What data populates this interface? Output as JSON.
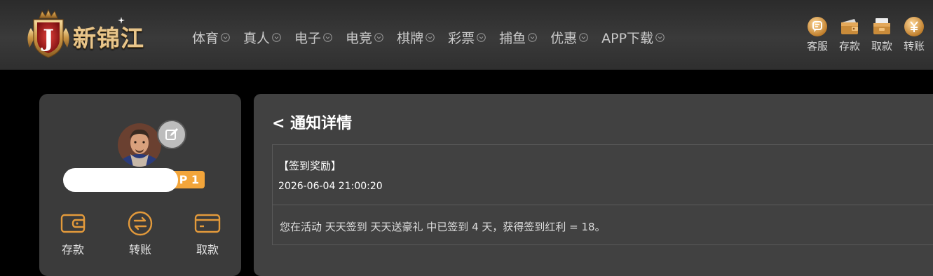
{
  "header": {
    "logo_text": "新锦江",
    "logo_letter": "J",
    "nav": [
      {
        "label": "体育"
      },
      {
        "label": "真人"
      },
      {
        "label": "电子"
      },
      {
        "label": "电竞"
      },
      {
        "label": "棋牌"
      },
      {
        "label": "彩票"
      },
      {
        "label": "捕鱼"
      },
      {
        "label": "优惠"
      },
      {
        "label": "APP下载"
      }
    ],
    "tools": [
      {
        "label": "客服",
        "icon": "customer-service-icon"
      },
      {
        "label": "存款",
        "icon": "wallet-icon"
      },
      {
        "label": "取款",
        "icon": "withdraw-icon"
      },
      {
        "label": "转账",
        "icon": "transfer-icon"
      }
    ]
  },
  "profile": {
    "vip_level": "P 1",
    "actions": [
      {
        "label": "存款",
        "icon": "wallet-icon"
      },
      {
        "label": "转账",
        "icon": "transfer-icon"
      },
      {
        "label": "取款",
        "icon": "card-icon"
      }
    ]
  },
  "detail": {
    "title": "< 通知详情",
    "notice_title": "【签到奖励】",
    "notice_time": "2026-06-04 21:00:20",
    "notice_body": "您在活动 天天签到 天天送豪礼 中已签到 4 天，获得签到红利 = 18。"
  },
  "colors": {
    "gold": "#e8c58a",
    "accent_orange": "#f3a53a",
    "panel": "#414141",
    "card": "#3b3b3b"
  }
}
